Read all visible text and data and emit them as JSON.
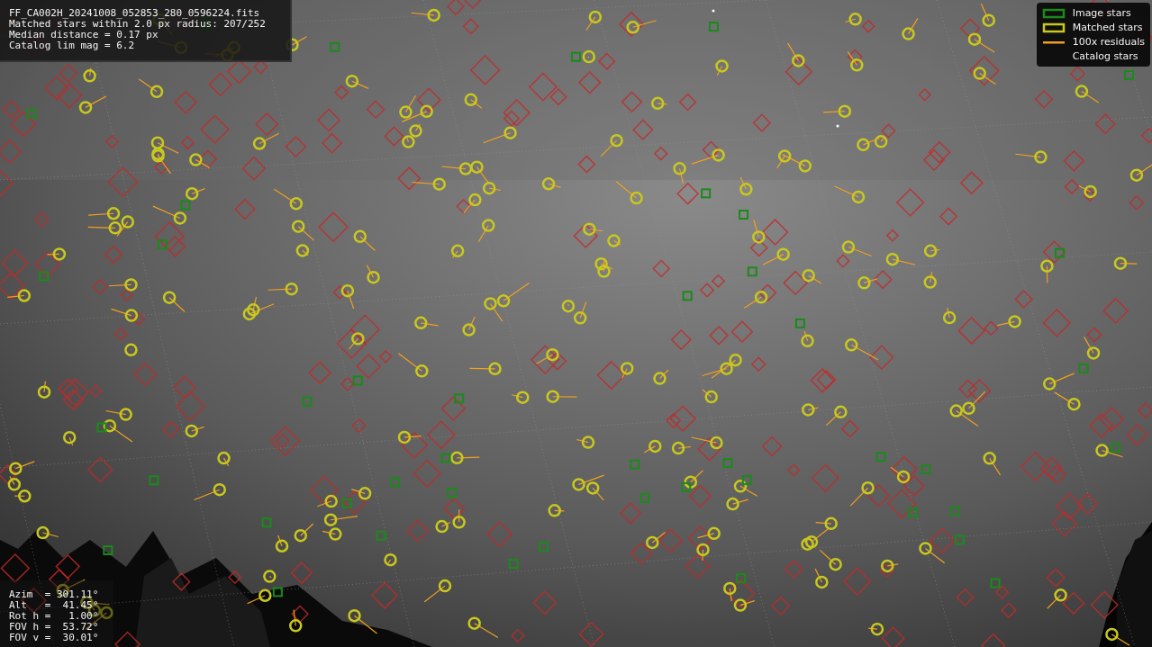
{
  "info": {
    "lines": [
      "FF_CA002H_20241008_052853_280_0596224.fits",
      "Matched stars within 2.0 px radius: 207/252",
      "Median distance = 0.17 px",
      "Catalog lim mag = 6.2"
    ]
  },
  "legend": [
    {
      "label": "Image stars",
      "kind": "box",
      "color": "#1a8a1a"
    },
    {
      "label": "Matched stars",
      "kind": "box",
      "color": "#c8c81e"
    },
    {
      "label": "100x residuals",
      "kind": "line",
      "color": "#f0a020"
    },
    {
      "label": "Catalog stars",
      "kind": "none"
    }
  ],
  "pointing": [
    "Azim  = 301.11°",
    "Alt   =  41.45°",
    "Rot h =   1.00°",
    "FOV h =  53.72°",
    "FOV v =  30.01°"
  ],
  "sky": {
    "kind": "landscape"
  }
}
